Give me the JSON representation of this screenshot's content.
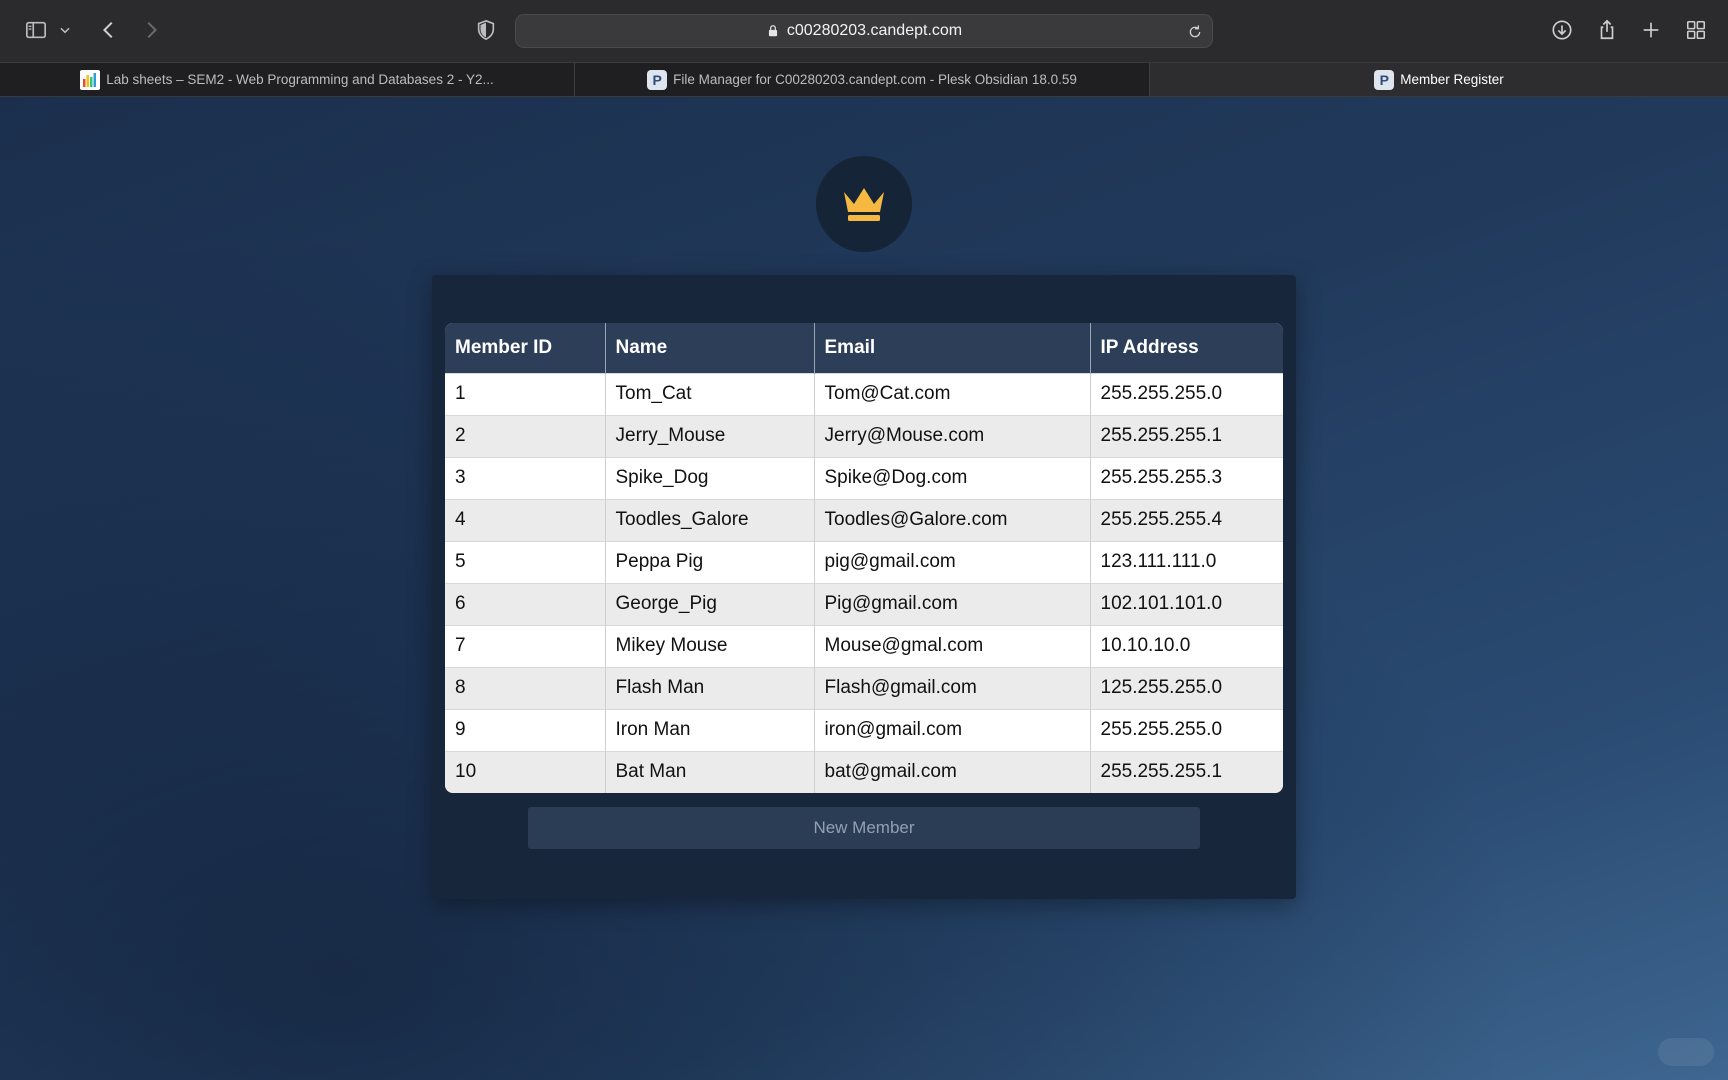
{
  "browser": {
    "url": "c00280203.candept.com",
    "tabs": [
      {
        "label": "Lab sheets – SEM2 - Web Programming and Databases 2 - Y2...",
        "active": false,
        "icon": "chart-favicon"
      },
      {
        "label": "File Manager for C00280203.candept.com - Plesk Obsidian 18.0.59",
        "active": false,
        "icon": "plesk-favicon"
      },
      {
        "label": "Member Register",
        "active": true,
        "icon": "plesk-favicon"
      }
    ],
    "icon_favicon_letter": "P"
  },
  "page": {
    "logo_icon": "crown-icon",
    "accent_color": "#f5b942",
    "table": {
      "headers": [
        "Member ID",
        "Name",
        "Email",
        "IP Address"
      ],
      "rows": [
        [
          "1",
          "Tom_Cat",
          "Tom@Cat.com",
          "255.255.255.0"
        ],
        [
          "2",
          "Jerry_Mouse",
          "Jerry@Mouse.com",
          "255.255.255.1"
        ],
        [
          "3",
          "Spike_Dog",
          "Spike@Dog.com",
          "255.255.255.3"
        ],
        [
          "4",
          "Toodles_Galore",
          "Toodles@Galore.com",
          "255.255.255.4"
        ],
        [
          "5",
          "Peppa Pig",
          "pig@gmail.com",
          "123.111.111.0"
        ],
        [
          "6",
          "George_Pig",
          "Pig@gmail.com",
          "102.101.101.0"
        ],
        [
          "7",
          "Mikey Mouse",
          "Mouse@gmal.com",
          "10.10.10.0"
        ],
        [
          "8",
          "Flash Man",
          "Flash@gmail.com",
          "125.255.255.0"
        ],
        [
          "9",
          "Iron Man",
          "iron@gmail.com",
          "255.255.255.0"
        ],
        [
          "10",
          "Bat Man",
          "bat@gmail.com",
          "255.255.255.1"
        ]
      ]
    },
    "new_member_label": "New Member"
  }
}
